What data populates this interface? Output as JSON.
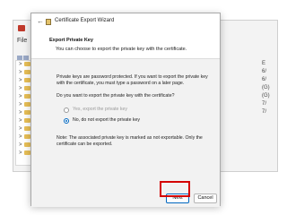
{
  "background_window": {
    "menu": "File",
    "right_column": [
      "E",
      "6/",
      "6/",
      "(G)",
      "(G)",
      "7/",
      "7/"
    ]
  },
  "wizard": {
    "title": "Certificate Export Wizard",
    "back_icon": "back-arrow-icon",
    "header_title": "Export Private Key",
    "header_subtitle": "You can choose to export the private key with the certificate.",
    "body_text_1": "Private keys are password protected. If you want to export the private key with the certificate, you must type a password on a later page.",
    "question": "Do you want to export the private key with the certificate?",
    "option_yes": "Yes, export the private key",
    "option_no": "No, do not export the private key",
    "selected_option": "no",
    "note": "Note: The associated private key is marked as not exportable. Only the certificate can be exported.",
    "next_label": "Next",
    "cancel_label": "Cancel"
  },
  "colors": {
    "accent": "#0067c0",
    "highlight": "#d40000",
    "folder": "#e8bf57"
  }
}
